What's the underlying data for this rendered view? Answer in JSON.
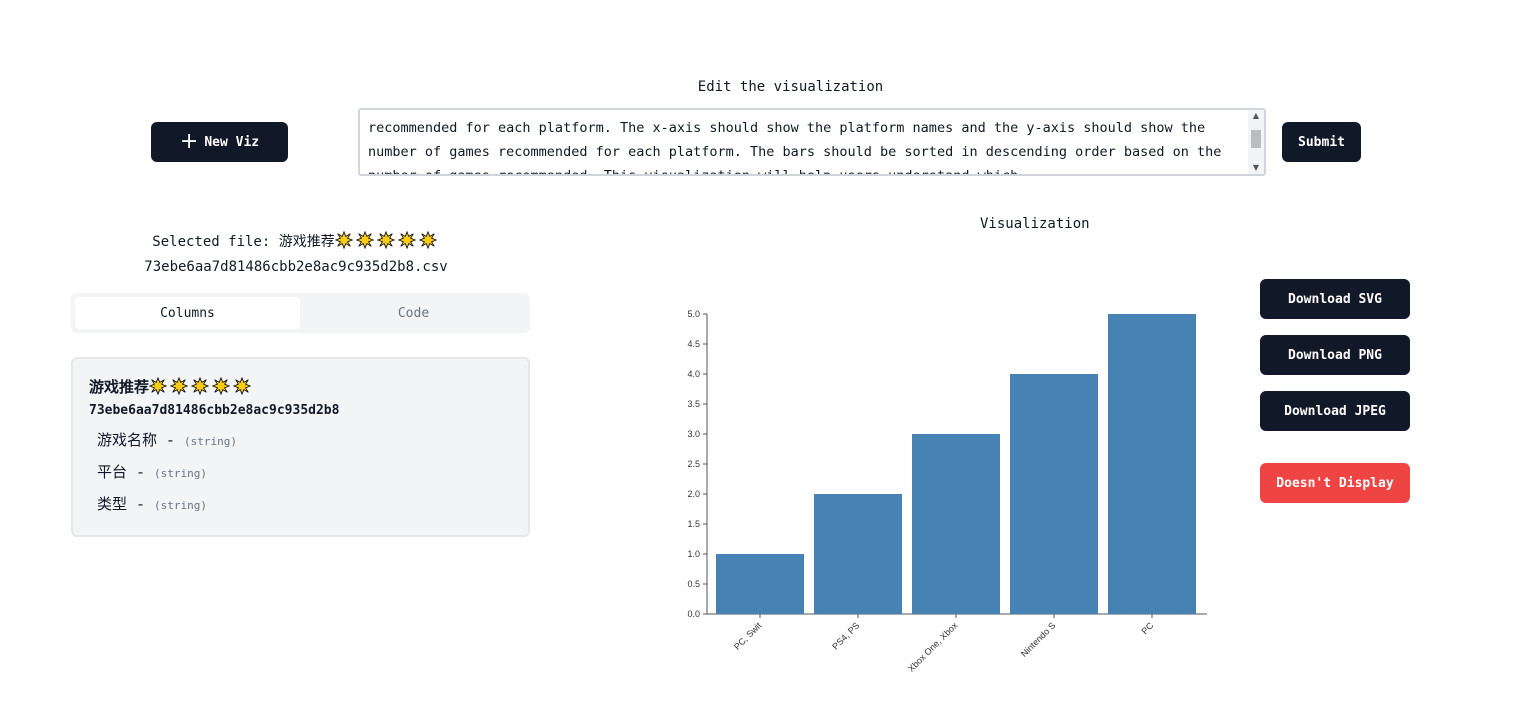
{
  "header": {
    "edit_title": "Edit the visualization",
    "new_viz_label": "New Viz",
    "prompt_text": "recommended for each platform. The x-axis should show the platform names and the y-axis should show the number of games recommended for each platform. The bars should be sorted in descending order based on the number of games recommended. This visualization will help users understand which",
    "submit_label": "Submit"
  },
  "file": {
    "selected_prefix": "Selected file: 游戏推荐",
    "hash_filename": "73ebe6aa7d81486cbb2e8ac9c935d2b8.csv",
    "dataset_name": "游戏推荐",
    "dataset_hash": "73ebe6aa7d81486cbb2e8ac9c935d2b8",
    "star_count": 5
  },
  "tabs": {
    "columns": "Columns",
    "code": "Code",
    "active": "Columns"
  },
  "columns": [
    {
      "name": "游戏名称",
      "sep": "-",
      "type": "(string)"
    },
    {
      "name": "平台",
      "sep": "-",
      "type": "(string)"
    },
    {
      "name": "类型",
      "sep": "-",
      "type": "(string)"
    }
  ],
  "viz": {
    "title": "Visualization",
    "download_svg": "Download SVG",
    "download_png": "Download PNG",
    "download_jpeg": "Download JPEG",
    "doesnt_display": "Doesn't Display"
  },
  "colors": {
    "bar": "#4682b4",
    "dark": "#111827",
    "danger": "#ef4444"
  },
  "chart_data": {
    "type": "bar",
    "categories": [
      "PC, Swit",
      "PS4, PS",
      "Xbox One, Xbox",
      "Nintendo S",
      "PC"
    ],
    "values": [
      1,
      2,
      3,
      4,
      5
    ],
    "ylim": [
      0,
      5
    ],
    "yticks": [
      "0.0",
      "0.5",
      "1.0",
      "1.5",
      "2.0",
      "2.5",
      "3.0",
      "3.5",
      "4.0",
      "4.5",
      "5.0"
    ],
    "title": "",
    "xlabel": "",
    "ylabel": ""
  }
}
